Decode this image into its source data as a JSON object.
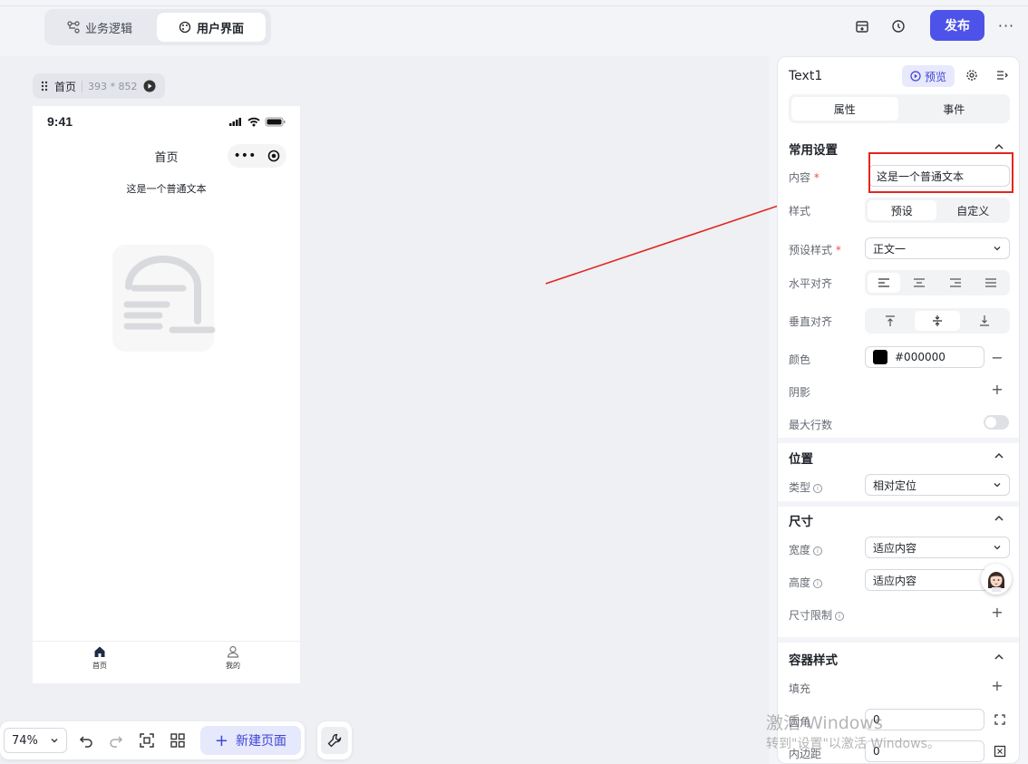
{
  "topbar": {
    "tabs": [
      {
        "label": "业务逻辑",
        "active": false
      },
      {
        "label": "用户界面",
        "active": true
      }
    ],
    "publish_label": "发布",
    "more_label": "···"
  },
  "canvas": {
    "page_chip": {
      "name": "首页",
      "dimensions": "393 * 852"
    },
    "phone": {
      "time": "9:41",
      "title": "首页",
      "text": "这是一个普通文本",
      "tabs": [
        {
          "label": "首页"
        },
        {
          "label": "我的"
        }
      ]
    }
  },
  "toolbar": {
    "zoom": "74%",
    "new_page_label": "新建页面"
  },
  "panel": {
    "component_name": "Text1",
    "preview_label": "预览",
    "tabs": [
      "属性",
      "事件"
    ],
    "common": {
      "title": "常用设置",
      "content_label": "内容",
      "content_value": "这是一个普通文本",
      "style_label": "样式",
      "style_options": [
        "预设",
        "自定义"
      ],
      "preset_label": "预设样式",
      "preset_value": "正文一",
      "halign_label": "水平对齐",
      "valign_label": "垂直对齐",
      "color_label": "颜色",
      "color_value": "#000000",
      "shadow_label": "阴影",
      "maxlines_label": "最大行数"
    },
    "position": {
      "title": "位置",
      "type_label": "类型",
      "type_value": "相对定位"
    },
    "size": {
      "title": "尺寸",
      "width_label": "宽度",
      "width_value": "适应内容",
      "height_label": "高度",
      "height_value": "适应内容",
      "limit_label": "尺寸限制"
    },
    "container": {
      "title": "容器样式",
      "fill_label": "填充",
      "radius_label": "圆角",
      "radius_value": "0",
      "padding_label": "内边距",
      "padding_value": "0"
    }
  },
  "watermark": {
    "line1": "激活 Windows",
    "line2": "转到\"设置\"以激活 Windows。"
  },
  "colors": {
    "accent": "#4d53e8",
    "highlight": "#e3261f"
  }
}
